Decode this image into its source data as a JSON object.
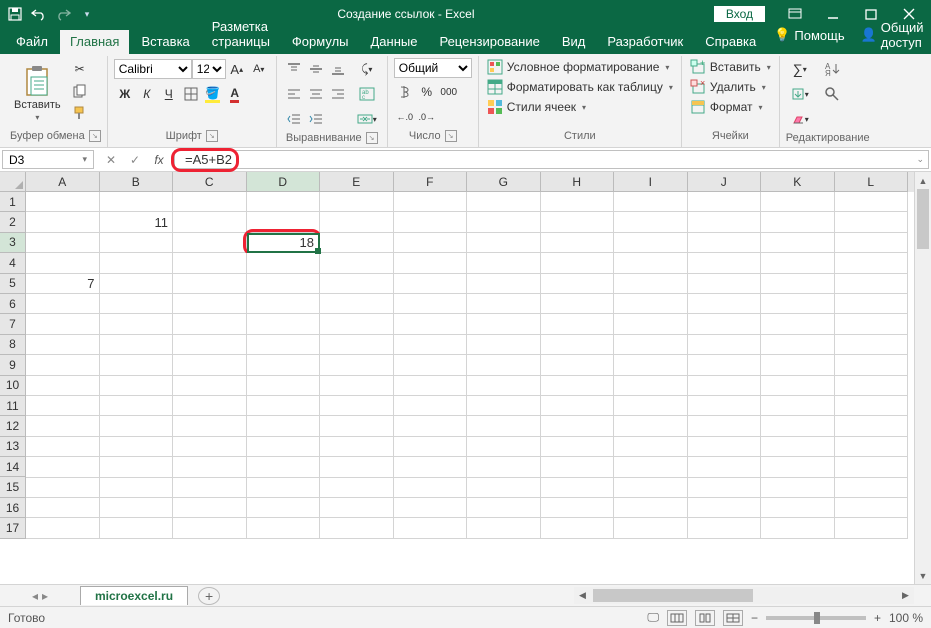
{
  "titlebar": {
    "title": "Создание ссылок - Excel",
    "login": "Вход"
  },
  "tabs": {
    "file": "Файл",
    "home": "Главная",
    "insert": "Вставка",
    "page_layout": "Разметка страницы",
    "formulas": "Формулы",
    "data": "Данные",
    "review": "Рецензирование",
    "view": "Вид",
    "developer": "Разработчик",
    "help": "Справка",
    "tellme": "Помощь",
    "share": "Общий доступ"
  },
  "ribbon": {
    "clipboard": {
      "title": "Буфер обмена",
      "paste": "Вставить"
    },
    "font": {
      "title": "Шрифт",
      "name": "Calibri",
      "size": "12",
      "bold": "Ж",
      "italic": "К",
      "underline": "Ч"
    },
    "alignment": {
      "title": "Выравнивание"
    },
    "number": {
      "title": "Число",
      "format": "Общий"
    },
    "styles": {
      "title": "Стили",
      "cond_fmt": "Условное форматирование",
      "fmt_table": "Форматировать как таблицу",
      "cell_styles": "Стили ячеек"
    },
    "cells": {
      "title": "Ячейки",
      "insert": "Вставить",
      "delete": "Удалить",
      "format": "Формат"
    },
    "editing": {
      "title": "Редактирование"
    }
  },
  "formula_bar": {
    "name_box": "D3",
    "formula": "=A5+B2"
  },
  "grid": {
    "columns": [
      "A",
      "B",
      "C",
      "D",
      "E",
      "F",
      "G",
      "H",
      "I",
      "J",
      "K",
      "L"
    ],
    "rows": [
      "1",
      "2",
      "3",
      "4",
      "5",
      "6",
      "7",
      "8",
      "9",
      "10",
      "11",
      "12",
      "13",
      "14",
      "15",
      "16",
      "17"
    ],
    "col_width": 73.5,
    "selected_col": "D",
    "selected_row": "3",
    "data": {
      "B2": "11",
      "A5": "7",
      "D3": "18"
    },
    "selected_cell": "D3"
  },
  "sheet": {
    "name": "microexcel.ru"
  },
  "statusbar": {
    "ready": "Готово",
    "zoom": "100 %"
  }
}
